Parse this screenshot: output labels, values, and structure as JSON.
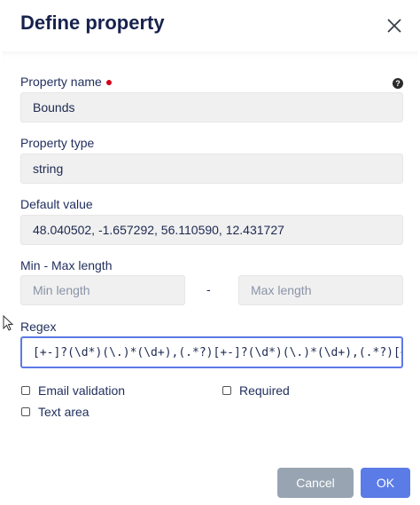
{
  "dialog": {
    "title": "Define property",
    "close_icon": "close-icon"
  },
  "form": {
    "property_name": {
      "label": "Property name",
      "value": "Bounds",
      "required": true,
      "help_icon": "help-icon"
    },
    "property_type": {
      "label": "Property type",
      "value": "string"
    },
    "default_value": {
      "label": "Default value",
      "value": "48.040502, -1.657292, 56.110590, 12.431727"
    },
    "length": {
      "label": "Min - Max length",
      "min_placeholder": "Min length",
      "separator": "-",
      "max_placeholder": "Max length"
    },
    "regex": {
      "label": "Regex",
      "value": "[+-]?(\\d*)(\\.)*(\\d+),(.*?)[+-]?(\\d*)(\\.)*(\\d+),(.*?)[+-]?(\\d*)(\\.)*("
    },
    "options": {
      "email_validation": {
        "label": "Email validation",
        "checked": false
      },
      "required": {
        "label": "Required",
        "checked": false
      },
      "text_area": {
        "label": "Text area",
        "checked": false
      }
    }
  },
  "buttons": {
    "cancel": "Cancel",
    "ok": "OK"
  },
  "colors": {
    "primary": "#5b7be6",
    "cancel": "#98a4b2",
    "required_dot": "#d0021b",
    "title": "#17224d"
  }
}
